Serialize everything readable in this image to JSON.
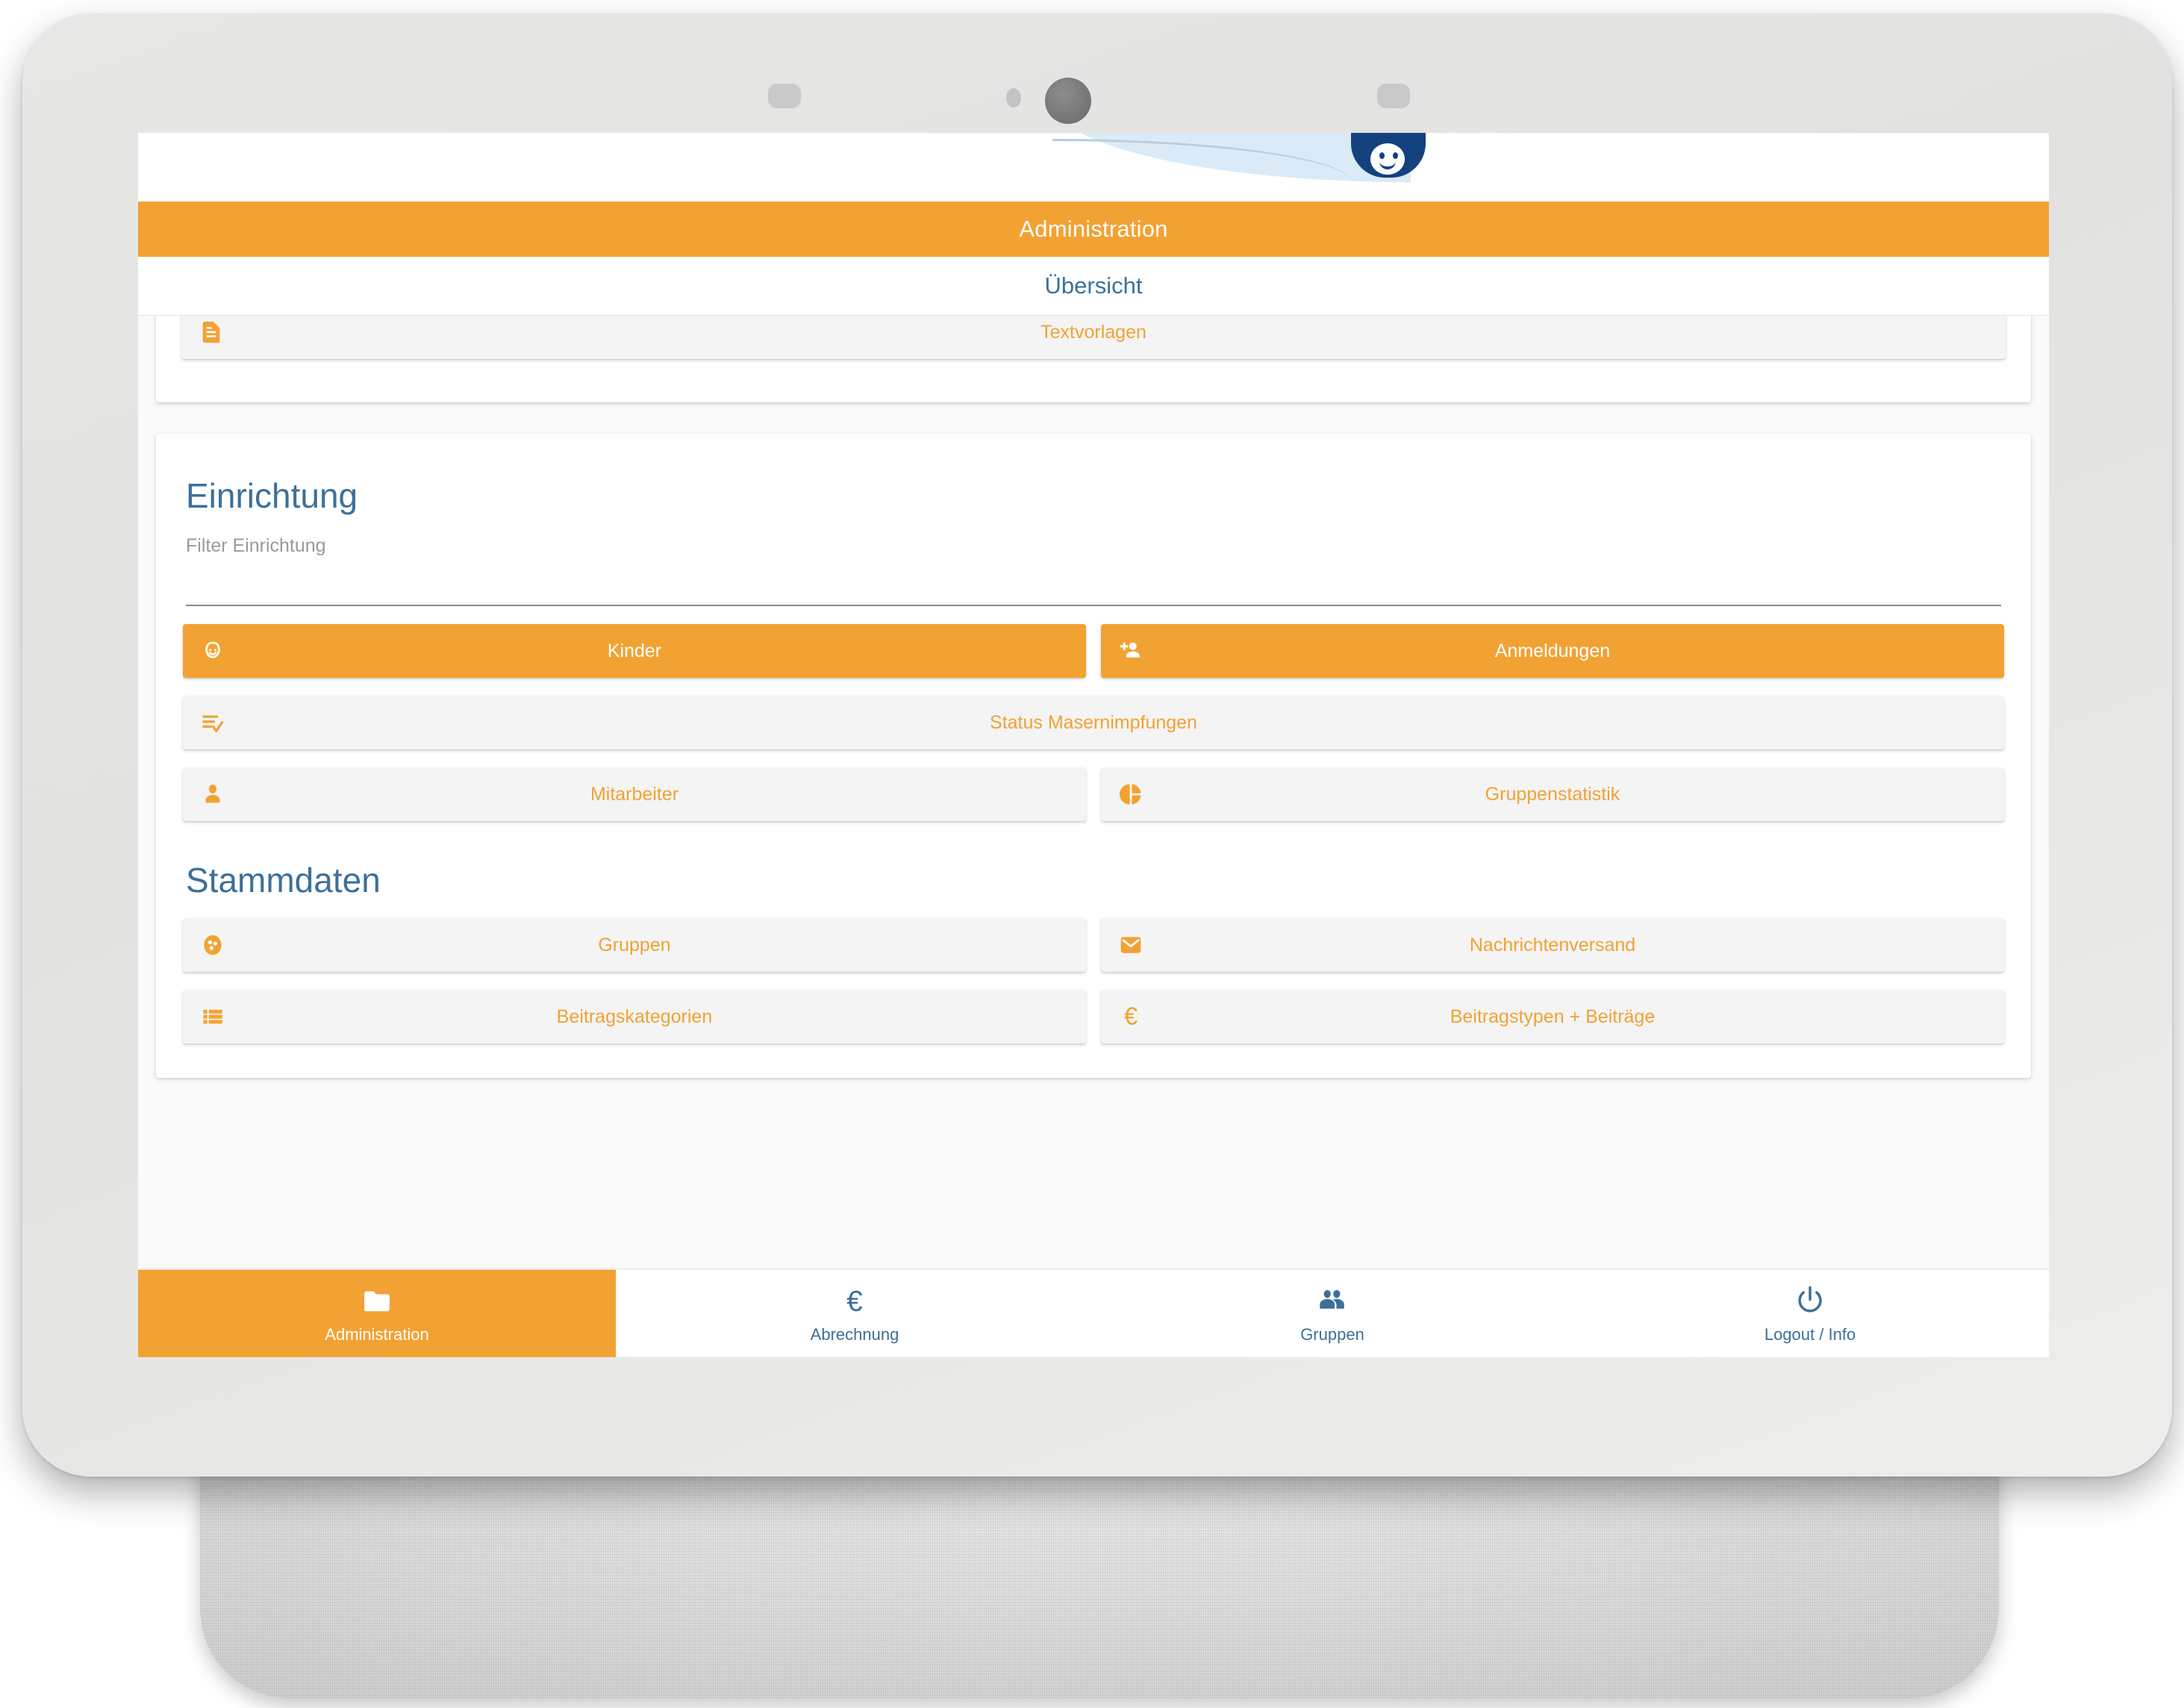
{
  "device": {
    "type": "smart-display-tablet",
    "camera_icon": "camera-lens-icon",
    "speaker_left_icon": "speaker-grill-icon",
    "speaker_right_icon": "speaker-grill-icon",
    "sensor_icon": "ambient-light-sensor-icon"
  },
  "colors": {
    "accent_orange": "#F2A233",
    "accent_blue": "#3D7099",
    "logo_blue": "#14427F",
    "logo_wave": "#DAEAF7",
    "tile_bg": "#F4F4F4",
    "screen_bg": "#FAFAFA",
    "placeholder_gray": "#9A9A9A"
  },
  "header": {
    "logo_icon": "smiley-badge-logo-icon",
    "title": "Administration"
  },
  "tabbar": {
    "tabs": [
      {
        "label": "Übersicht",
        "active": true
      }
    ]
  },
  "top_card": {
    "tiles": [
      {
        "label": "Textvorlagen",
        "icon": "document-text-icon",
        "style": "secondary"
      }
    ]
  },
  "einrichtung": {
    "title": "Einrichtung",
    "filter": {
      "label": "Filter Einrichtung",
      "placeholder": "Filter Einrichtung",
      "value": ""
    },
    "rows": [
      [
        {
          "label": "Kinder",
          "icon": "child-face-icon",
          "style": "primary"
        },
        {
          "label": "Anmeldungen",
          "icon": "person-add-icon",
          "style": "primary"
        }
      ],
      [
        {
          "label": "Status Masernimpfungen",
          "icon": "playlist-check-icon",
          "style": "secondary",
          "full_width": true
        }
      ],
      [
        {
          "label": "Mitarbeiter",
          "icon": "person-icon",
          "style": "secondary"
        },
        {
          "label": "Gruppenstatistik",
          "icon": "pie-chart-icon",
          "style": "secondary"
        }
      ]
    ]
  },
  "stammdaten": {
    "title": "Stammdaten",
    "rows": [
      [
        {
          "label": "Gruppen",
          "icon": "bubble-group-icon",
          "style": "secondary"
        },
        {
          "label": "Nachrichtenversand",
          "icon": "mail-envelope-icon",
          "style": "secondary"
        }
      ],
      [
        {
          "label": "Beitragskategorien",
          "icon": "list-table-icon",
          "style": "secondary"
        },
        {
          "label": "Beitragstypen + Beiträge",
          "icon": "euro-icon",
          "style": "secondary"
        }
      ]
    ]
  },
  "bottom_nav": {
    "items": [
      {
        "label": "Administration",
        "icon": "folder-icon",
        "active": true
      },
      {
        "label": "Abrechnung",
        "icon": "euro-icon",
        "active": false
      },
      {
        "label": "Gruppen",
        "icon": "people-icon",
        "active": false
      },
      {
        "label": "Logout / Info",
        "icon": "power-icon",
        "active": false
      }
    ]
  }
}
